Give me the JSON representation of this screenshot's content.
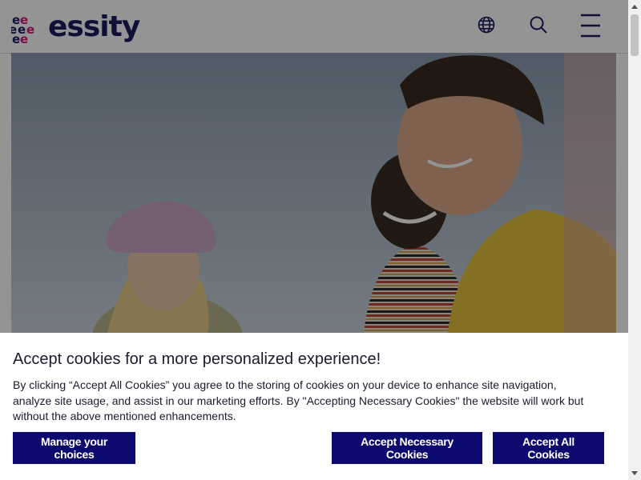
{
  "header": {
    "logo_text": "essity",
    "icons": [
      "globe-icon",
      "search-icon",
      "hamburger-menu-icon"
    ]
  },
  "colors": {
    "brand_navy": "#1a1a60",
    "button_bg": "#0c0a6e",
    "logo_magenta": "#d6187a"
  },
  "cookie": {
    "title": "Accept cookies for a more personalized experience!",
    "body": "By clicking “Accept All Cookies” you agree to the storing of cookies on your device to enhance site navigation, analyze site usage, and assist in our marketing efforts. By \"Accepting Necessary Cookies\" the website will work but without the above mentioned enhancements.",
    "manage_label": "Manage your choices",
    "necessary_label": "Accept Necessary Cookies",
    "accept_all_label": "Accept All Cookies"
  }
}
